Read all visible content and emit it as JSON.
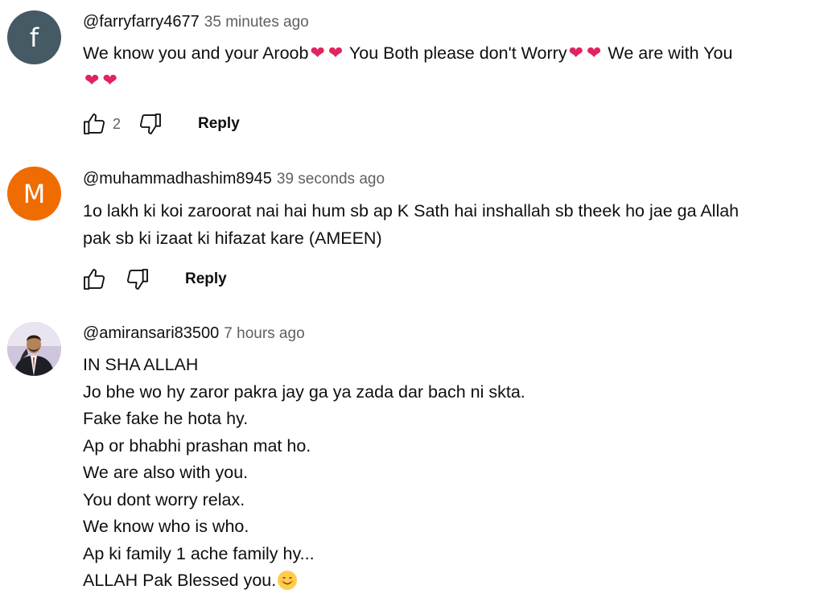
{
  "comments": [
    {
      "avatar_letter": "f",
      "avatar_color": "#455a64",
      "author": "@farryfarry4677",
      "time": "35 minutes ago",
      "line1_parts": [
        "We know you and your Aroob",
        " You Both please don't Worry",
        " We are with You"
      ],
      "likes": "2",
      "reply_label": "Reply"
    },
    {
      "avatar_letter": "M",
      "avatar_color": "#ef6c00",
      "author": "@muhammadhashim8945",
      "time": "39 seconds ago",
      "lines": [
        "1o lakh ki koi zaroorat nai hai  hum sb ap K Sath  hai inshallah  sb theek ho jae ga Allah",
        "pak sb ki izaat ki hifazat kare (AMEEN)"
      ],
      "reply_label": "Reply"
    },
    {
      "author": "@amiransari83500",
      "time": "7 hours ago",
      "lines": [
        "IN SHA ALLAH",
        "Jo bhe wo hy zaror pakra jay ga ya zada dar bach ni skta.",
        "Fake fake he hota hy.",
        "Ap or bhabhi prashan mat ho.",
        "We are also with you.",
        "You dont worry relax.",
        "We know who is who.",
        "Ap ki family 1 ache family hy...",
        "ALLAH Pak Blessed you."
      ]
    }
  ],
  "heart_color": "#e0245e"
}
